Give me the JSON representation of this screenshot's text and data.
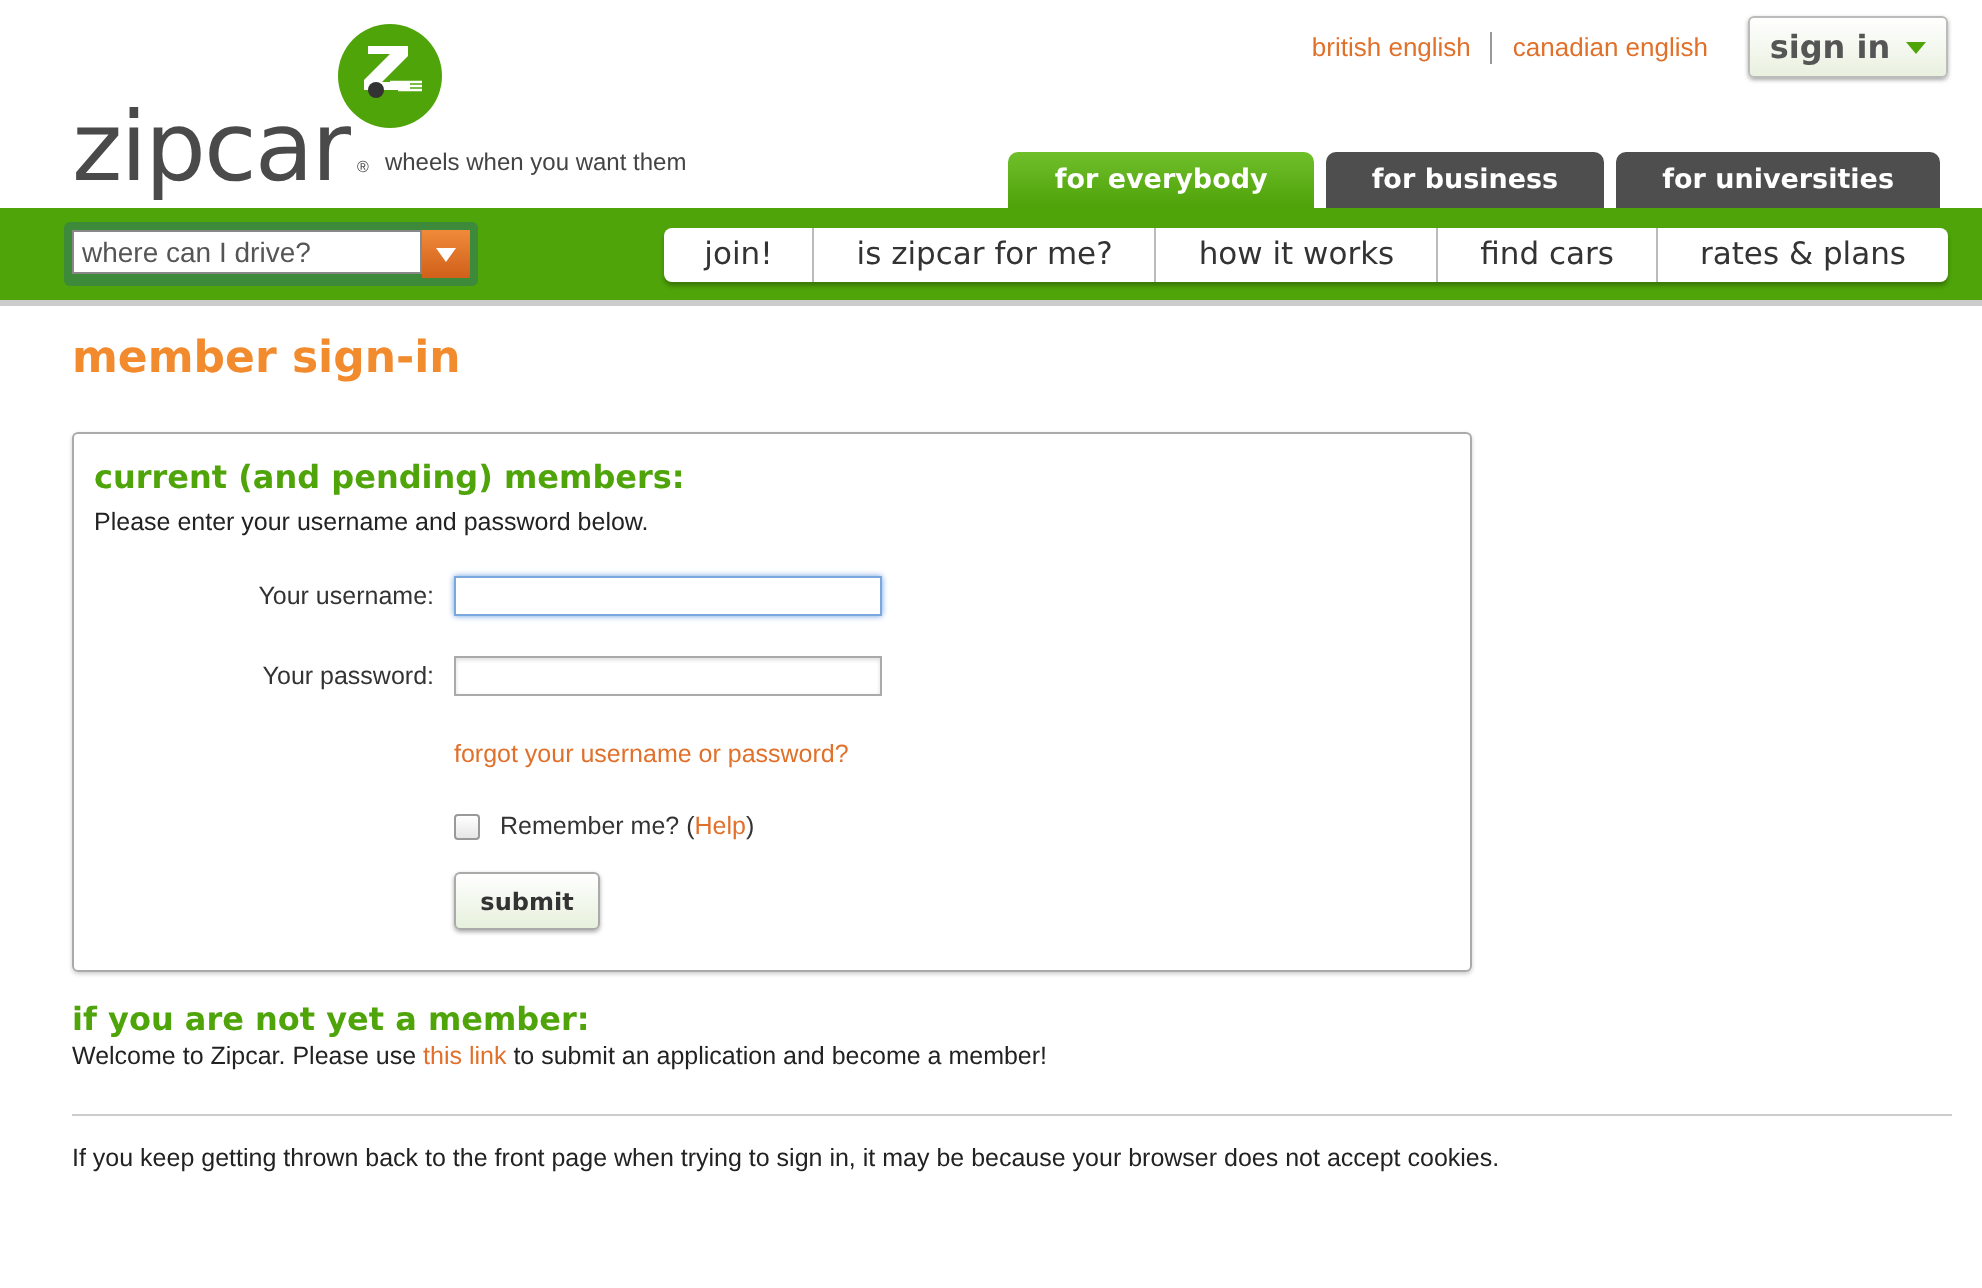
{
  "logo": {
    "wordmark": "zipcar",
    "registered": "®",
    "tagline": "wheels when you want them"
  },
  "languages": [
    "british english",
    "canadian english"
  ],
  "sign_in_button": "sign in",
  "audience_tabs": [
    {
      "label": "for everybody",
      "selected": true
    },
    {
      "label": "for business",
      "selected": false
    },
    {
      "label": "for universities",
      "selected": false
    }
  ],
  "search": {
    "placeholder": "where can I drive?"
  },
  "nav": [
    "join!",
    "is zipcar for me?",
    "how it works",
    "find cars",
    "rates & plans"
  ],
  "page_title": "member sign-in",
  "members_box": {
    "heading": "current (and pending) members:",
    "intro": "Please enter your username and password below.",
    "fields": [
      {
        "label": "Your username:",
        "focused": true
      },
      {
        "label": "Your password:",
        "focused": false
      }
    ],
    "forgot_link": "forgot your username or password?",
    "remember": {
      "checked": false,
      "before": "Remember me? (",
      "link": "Help",
      "after": ")"
    },
    "submit": "submit"
  },
  "not_member": {
    "heading": "if you are not yet a member:",
    "before": "Welcome to Zipcar. Please use ",
    "link": "this link",
    "after": " to submit an application and become a member!"
  },
  "footer_note": "If you keep getting thrown back to the front page when trying to sign in, it may be because your browser does not accept cookies."
}
